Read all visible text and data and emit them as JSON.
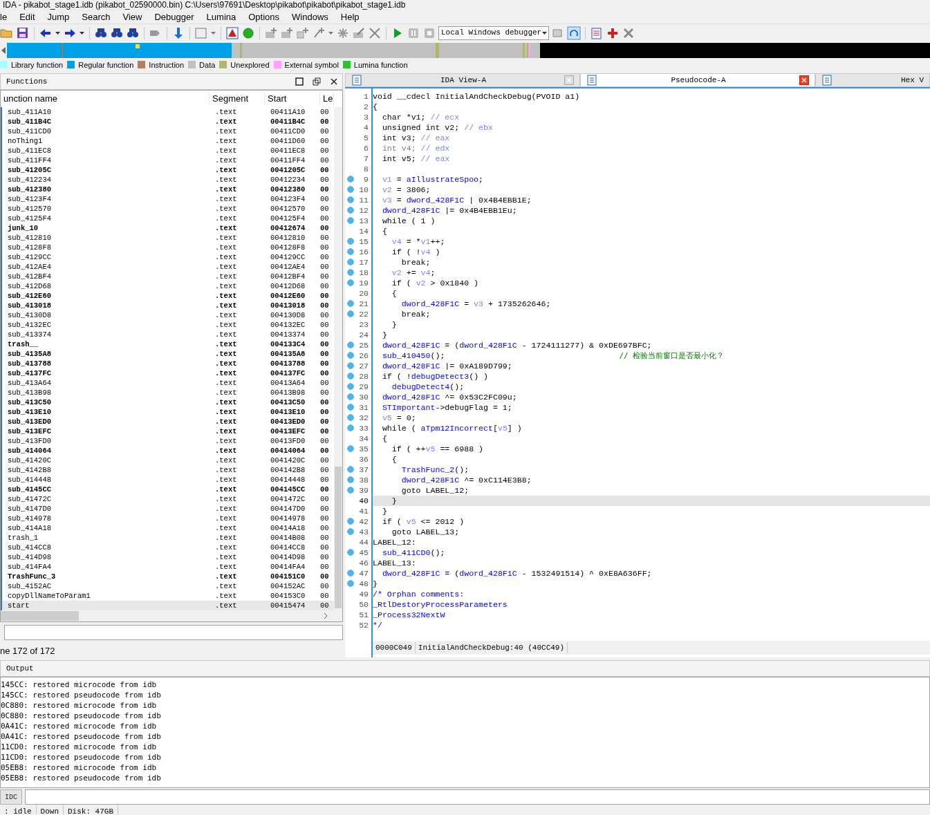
{
  "window": {
    "title": "IDA - pikabot_stage1.idb (pikabot_02590000.bin) C:\\Users\\97691\\Desktop\\pikabot\\pikabot\\pikabot_stage1.idb"
  },
  "menu": [
    "le",
    "Edit",
    "Jump",
    "Search",
    "View",
    "Debugger",
    "Lumina",
    "Options",
    "Windows",
    "Help"
  ],
  "debugger_select": {
    "value": "Local Windows debugger"
  },
  "legend": [
    {
      "label": "Library function",
      "color": "#a6ffff"
    },
    {
      "label": "Regular function",
      "color": "#00a0e6"
    },
    {
      "label": "Instruction",
      "color": "#b47f5c"
    },
    {
      "label": "Data",
      "color": "#c0c0c0"
    },
    {
      "label": "Unexplored",
      "color": "#b4b46e"
    },
    {
      "label": "External symbol",
      "color": "#ffa0ff"
    },
    {
      "label": "Lumina function",
      "color": "#30c030"
    }
  ],
  "functions": {
    "title": "Functions",
    "columns": [
      "unction name",
      "Segment",
      "Start",
      "Le"
    ],
    "rows": [
      {
        "name": "sub_411A10",
        "segment": ".text",
        "start": "00411A10",
        "length": "00",
        "bold": false,
        "selected": false
      },
      {
        "name": "sub_411B4C",
        "segment": ".text",
        "start": "00411B4C",
        "length": "00",
        "bold": true,
        "selected": false
      },
      {
        "name": "sub_411CD0",
        "segment": ".text",
        "start": "00411CD0",
        "length": "00",
        "bold": false,
        "selected": false
      },
      {
        "name": "noThing1",
        "segment": ".text",
        "start": "00411D60",
        "length": "00",
        "bold": false,
        "selected": false
      },
      {
        "name": "sub_411EC8",
        "segment": ".text",
        "start": "00411EC8",
        "length": "00",
        "bold": false,
        "selected": false
      },
      {
        "name": "sub_411FF4",
        "segment": ".text",
        "start": "00411FF4",
        "length": "00",
        "bold": false,
        "selected": false
      },
      {
        "name": "sub_41205C",
        "segment": ".text",
        "start": "0041205C",
        "length": "00",
        "bold": true,
        "selected": false
      },
      {
        "name": "sub_412234",
        "segment": ".text",
        "start": "00412234",
        "length": "00",
        "bold": false,
        "selected": false
      },
      {
        "name": "sub_412380",
        "segment": ".text",
        "start": "00412380",
        "length": "00",
        "bold": true,
        "selected": false
      },
      {
        "name": "sub_4123F4",
        "segment": ".text",
        "start": "004123F4",
        "length": "00",
        "bold": false,
        "selected": false
      },
      {
        "name": "sub_412570",
        "segment": ".text",
        "start": "00412570",
        "length": "00",
        "bold": false,
        "selected": false
      },
      {
        "name": "sub_4125F4",
        "segment": ".text",
        "start": "004125F4",
        "length": "00",
        "bold": false,
        "selected": false
      },
      {
        "name": "junk_10",
        "segment": ".text",
        "start": "00412674",
        "length": "00",
        "bold": true,
        "selected": false
      },
      {
        "name": "sub_412810",
        "segment": ".text",
        "start": "00412810",
        "length": "00",
        "bold": false,
        "selected": false
      },
      {
        "name": "sub_4128F8",
        "segment": ".text",
        "start": "004128F8",
        "length": "00",
        "bold": false,
        "selected": false
      },
      {
        "name": "sub_4129CC",
        "segment": ".text",
        "start": "004129CC",
        "length": "00",
        "bold": false,
        "selected": false
      },
      {
        "name": "sub_412AE4",
        "segment": ".text",
        "start": "00412AE4",
        "length": "00",
        "bold": false,
        "selected": false
      },
      {
        "name": "sub_412BF4",
        "segment": ".text",
        "start": "00412BF4",
        "length": "00",
        "bold": false,
        "selected": false
      },
      {
        "name": "sub_412D68",
        "segment": ".text",
        "start": "00412D68",
        "length": "00",
        "bold": false,
        "selected": false
      },
      {
        "name": "sub_412E60",
        "segment": ".text",
        "start": "00412E60",
        "length": "00",
        "bold": true,
        "selected": false
      },
      {
        "name": "sub_413018",
        "segment": ".text",
        "start": "00413018",
        "length": "00",
        "bold": true,
        "selected": false
      },
      {
        "name": "sub_4130D8",
        "segment": ".text",
        "start": "004130D8",
        "length": "00",
        "bold": false,
        "selected": false
      },
      {
        "name": "sub_4132EC",
        "segment": ".text",
        "start": "004132EC",
        "length": "00",
        "bold": false,
        "selected": false
      },
      {
        "name": "sub_413374",
        "segment": ".text",
        "start": "00413374",
        "length": "00",
        "bold": false,
        "selected": false
      },
      {
        "name": "trash__",
        "segment": ".text",
        "start": "004133C4",
        "length": "00",
        "bold": true,
        "selected": false
      },
      {
        "name": "sub_4135A8",
        "segment": ".text",
        "start": "004135A8",
        "length": "00",
        "bold": true,
        "selected": false
      },
      {
        "name": "sub_413788",
        "segment": ".text",
        "start": "00413788",
        "length": "00",
        "bold": true,
        "selected": false
      },
      {
        "name": "sub_4137FC",
        "segment": ".text",
        "start": "004137FC",
        "length": "00",
        "bold": true,
        "selected": false
      },
      {
        "name": "sub_413A64",
        "segment": ".text",
        "start": "00413A64",
        "length": "00",
        "bold": false,
        "selected": false
      },
      {
        "name": "sub_413B98",
        "segment": ".text",
        "start": "00413B98",
        "length": "00",
        "bold": false,
        "selected": false
      },
      {
        "name": "sub_413C50",
        "segment": ".text",
        "start": "00413C50",
        "length": "00",
        "bold": true,
        "selected": false
      },
      {
        "name": "sub_413E10",
        "segment": ".text",
        "start": "00413E10",
        "length": "00",
        "bold": true,
        "selected": false
      },
      {
        "name": "sub_413ED0",
        "segment": ".text",
        "start": "00413ED0",
        "length": "00",
        "bold": true,
        "selected": false
      },
      {
        "name": "sub_413EFC",
        "segment": ".text",
        "start": "00413EFC",
        "length": "00",
        "bold": true,
        "selected": false
      },
      {
        "name": "sub_413FD0",
        "segment": ".text",
        "start": "00413FD0",
        "length": "00",
        "bold": false,
        "selected": false
      },
      {
        "name": "sub_414064",
        "segment": ".text",
        "start": "00414064",
        "length": "00",
        "bold": true,
        "selected": false
      },
      {
        "name": "sub_41420C",
        "segment": ".text",
        "start": "0041420C",
        "length": "00",
        "bold": false,
        "selected": false
      },
      {
        "name": "sub_4142B8",
        "segment": ".text",
        "start": "004142B8",
        "length": "00",
        "bold": false,
        "selected": false
      },
      {
        "name": "sub_414448",
        "segment": ".text",
        "start": "00414448",
        "length": "00",
        "bold": false,
        "selected": false
      },
      {
        "name": "sub_4145CC",
        "segment": ".text",
        "start": "004145CC",
        "length": "00",
        "bold": true,
        "selected": false
      },
      {
        "name": "sub_41472C",
        "segment": ".text",
        "start": "0041472C",
        "length": "00",
        "bold": false,
        "selected": false
      },
      {
        "name": "sub_4147D0",
        "segment": ".text",
        "start": "004147D0",
        "length": "00",
        "bold": false,
        "selected": false
      },
      {
        "name": "sub_414978",
        "segment": ".text",
        "start": "00414978",
        "length": "00",
        "bold": false,
        "selected": false
      },
      {
        "name": "sub_414A18",
        "segment": ".text",
        "start": "00414A18",
        "length": "00",
        "bold": false,
        "selected": false
      },
      {
        "name": "trash_1",
        "segment": ".text",
        "start": "00414B08",
        "length": "00",
        "bold": false,
        "selected": false
      },
      {
        "name": "sub_414CC8",
        "segment": ".text",
        "start": "00414CC8",
        "length": "00",
        "bold": false,
        "selected": false
      },
      {
        "name": "sub_414D98",
        "segment": ".text",
        "start": "00414D98",
        "length": "00",
        "bold": false,
        "selected": false
      },
      {
        "name": "sub_414FA4",
        "segment": ".text",
        "start": "00414FA4",
        "length": "00",
        "bold": false,
        "selected": false
      },
      {
        "name": "TrashFunc_3",
        "segment": ".text",
        "start": "004151C0",
        "length": "00",
        "bold": true,
        "selected": false
      },
      {
        "name": "sub_4152AC",
        "segment": ".text",
        "start": "004152AC",
        "length": "00",
        "bold": false,
        "selected": false
      },
      {
        "name": "copyDllNameToParam1",
        "segment": ".text",
        "start": "004153C0",
        "length": "00",
        "bold": false,
        "selected": false
      },
      {
        "name": "start",
        "segment": ".text",
        "start": "00415474",
        "length": "00",
        "bold": false,
        "selected": true
      }
    ],
    "footer": "ne 172 of 172"
  },
  "tabs": [
    {
      "label": "IDA View-A",
      "selected": false,
      "closable": true
    },
    {
      "label": "Pseudocode-A",
      "selected": true,
      "closable": true
    },
    {
      "label": "Hex V",
      "selected": false,
      "closable": false
    }
  ],
  "code_lines": [
    {
      "number": "1",
      "dot": false,
      "highlighted": false,
      "parts": [
        {
          "kind": "plain",
          "text": "void __cdecl InitialAndCheckDebug(PVOID a1)"
        }
      ]
    },
    {
      "number": "2",
      "dot": false,
      "highlighted": false,
      "parts": [
        {
          "kind": "plain",
          "text": "{"
        }
      ]
    },
    {
      "number": "3",
      "dot": false,
      "highlighted": false,
      "parts": [
        {
          "kind": "plain",
          "text": "  char *v1; "
        },
        {
          "kind": "local",
          "text": "// ecx"
        }
      ]
    },
    {
      "number": "4",
      "dot": false,
      "highlighted": false,
      "parts": [
        {
          "kind": "plain",
          "text": "  unsigned int v2; "
        },
        {
          "kind": "local",
          "text": "// ebx"
        }
      ]
    },
    {
      "number": "5",
      "dot": false,
      "highlighted": false,
      "parts": [
        {
          "kind": "plain",
          "text": "  int v3; "
        },
        {
          "kind": "local",
          "text": "// eax"
        }
      ]
    },
    {
      "number": "6",
      "dot": false,
      "highlighted": false,
      "parts": [
        {
          "kind": "dim",
          "text": "  int v4; "
        },
        {
          "kind": "local",
          "text": "// edx"
        }
      ]
    },
    {
      "number": "7",
      "dot": false,
      "highlighted": false,
      "parts": [
        {
          "kind": "plain",
          "text": "  int v5; "
        },
        {
          "kind": "local",
          "text": "// eax"
        }
      ]
    },
    {
      "number": "8",
      "dot": false,
      "highlighted": false
    },
    {
      "number": "9",
      "dot": true,
      "highlighted": false,
      "parts": [
        {
          "kind": "local",
          "text": "  v1"
        },
        {
          "kind": "plain",
          "text": " = "
        },
        {
          "kind": "global",
          "text": "aIllustrateSpoo"
        },
        {
          "kind": "plain",
          "text": ";"
        }
      ]
    },
    {
      "number": "10",
      "dot": true,
      "highlighted": false,
      "parts": [
        {
          "kind": "local",
          "text": "  v2"
        },
        {
          "kind": "plain",
          "text": " = 3806;"
        }
      ]
    },
    {
      "number": "11",
      "dot": true,
      "highlighted": false,
      "parts": [
        {
          "kind": "local",
          "text": "  v3"
        },
        {
          "kind": "plain",
          "text": " = "
        },
        {
          "kind": "global",
          "text": "dword_428F1C"
        },
        {
          "kind": "plain",
          "text": " | 0x4B4EBB1E;"
        }
      ]
    },
    {
      "number": "12",
      "dot": true,
      "highlighted": false,
      "parts": [
        {
          "kind": "global",
          "text": "  dword_428F1C"
        },
        {
          "kind": "plain",
          "text": " |= 0x4B4EBB1Eu;"
        }
      ]
    },
    {
      "number": "13",
      "dot": true,
      "highlighted": false,
      "parts": [
        {
          "kind": "plain",
          "text": "  while ( 1 )"
        }
      ]
    },
    {
      "number": "14",
      "dot": false,
      "highlighted": false,
      "parts": [
        {
          "kind": "plain",
          "text": "  {"
        }
      ]
    },
    {
      "number": "15",
      "dot": true,
      "highlighted": false,
      "parts": [
        {
          "kind": "local",
          "text": "    v4"
        },
        {
          "kind": "plain",
          "text": " = *"
        },
        {
          "kind": "local",
          "text": "v1"
        },
        {
          "kind": "plain",
          "text": "++;"
        }
      ]
    },
    {
      "number": "16",
      "dot": true,
      "highlighted": false,
      "parts": [
        {
          "kind": "plain",
          "text": "    if ( !"
        },
        {
          "kind": "local",
          "text": "v4"
        },
        {
          "kind": "plain",
          "text": " )"
        }
      ]
    },
    {
      "number": "17",
      "dot": true,
      "highlighted": false,
      "parts": [
        {
          "kind": "plain",
          "text": "      break;"
        }
      ]
    },
    {
      "number": "18",
      "dot": true,
      "highlighted": false,
      "parts": [
        {
          "kind": "local",
          "text": "    v2"
        },
        {
          "kind": "plain",
          "text": " += "
        },
        {
          "kind": "local",
          "text": "v4"
        },
        {
          "kind": "plain",
          "text": ";"
        }
      ]
    },
    {
      "number": "19",
      "dot": true,
      "highlighted": false,
      "parts": [
        {
          "kind": "plain",
          "text": "    if ( "
        },
        {
          "kind": "local",
          "text": "v2"
        },
        {
          "kind": "plain",
          "text": " > 0x1840 )"
        }
      ]
    },
    {
      "number": "20",
      "dot": false,
      "highlighted": false,
      "parts": [
        {
          "kind": "plain",
          "text": "    {"
        }
      ]
    },
    {
      "number": "21",
      "dot": true,
      "highlighted": false,
      "parts": [
        {
          "kind": "global",
          "text": "      dword_428F1C"
        },
        {
          "kind": "plain",
          "text": " = "
        },
        {
          "kind": "local",
          "text": "v3"
        },
        {
          "kind": "plain",
          "text": " + 1735262646;"
        }
      ]
    },
    {
      "number": "22",
      "dot": true,
      "highlighted": false,
      "parts": [
        {
          "kind": "plain",
          "text": "      break;"
        }
      ]
    },
    {
      "number": "23",
      "dot": false,
      "highlighted": false,
      "parts": [
        {
          "kind": "plain",
          "text": "    }"
        }
      ]
    },
    {
      "number": "24",
      "dot": false,
      "highlighted": false,
      "parts": [
        {
          "kind": "plain",
          "text": "  }"
        }
      ]
    },
    {
      "number": "25",
      "dot": true,
      "highlighted": false,
      "parts": [
        {
          "kind": "global",
          "text": "  dword_428F1C"
        },
        {
          "kind": "plain",
          "text": " = ("
        },
        {
          "kind": "global",
          "text": "dword_428F1C"
        },
        {
          "kind": "plain",
          "text": " - 1724111277) & 0xDE697BFC;"
        }
      ]
    },
    {
      "number": "26",
      "dot": true,
      "highlighted": false,
      "parts": [
        {
          "kind": "global",
          "text": "  sub_410450"
        },
        {
          "kind": "plain",
          "text": "();"
        },
        {
          "kind": "comment",
          "text": "// 检验当前窗口是否最小化？"
        }
      ]
    },
    {
      "number": "27",
      "dot": true,
      "highlighted": false,
      "parts": [
        {
          "kind": "global",
          "text": "  dword_428F1C"
        },
        {
          "kind": "plain",
          "text": " |= 0xA189D799;"
        }
      ]
    },
    {
      "number": "28",
      "dot": true,
      "highlighted": false,
      "parts": [
        {
          "kind": "plain",
          "text": "  if ( !"
        },
        {
          "kind": "global",
          "text": "debugDetect3"
        },
        {
          "kind": "plain",
          "text": "() )"
        }
      ]
    },
    {
      "number": "29",
      "dot": true,
      "highlighted": false,
      "parts": [
        {
          "kind": "global",
          "text": "    debugDetect4"
        },
        {
          "kind": "plain",
          "text": "();"
        }
      ]
    },
    {
      "number": "30",
      "dot": true,
      "highlighted": false,
      "parts": [
        {
          "kind": "global",
          "text": "  dword_428F1C"
        },
        {
          "kind": "plain",
          "text": " ^= 0x53C2FC09u;"
        }
      ]
    },
    {
      "number": "31",
      "dot": true,
      "highlighted": false,
      "parts": [
        {
          "kind": "global",
          "text": "  STImportant"
        },
        {
          "kind": "plain",
          "text": "->debugFlag = 1;"
        }
      ]
    },
    {
      "number": "32",
      "dot": true,
      "highlighted": false,
      "parts": [
        {
          "kind": "local",
          "text": "  v5"
        },
        {
          "kind": "plain",
          "text": " = 0;"
        }
      ]
    },
    {
      "number": "33",
      "dot": true,
      "highlighted": false,
      "parts": [
        {
          "kind": "plain",
          "text": "  while ( "
        },
        {
          "kind": "global",
          "text": "aTpm12Incorrect"
        },
        {
          "kind": "plain",
          "text": "["
        },
        {
          "kind": "local",
          "text": "v5"
        },
        {
          "kind": "plain",
          "text": "] )"
        }
      ]
    },
    {
      "number": "34",
      "dot": false,
      "highlighted": false,
      "parts": [
        {
          "kind": "plain",
          "text": "  {"
        }
      ]
    },
    {
      "number": "35",
      "dot": true,
      "highlighted": false,
      "parts": [
        {
          "kind": "plain",
          "text": "    if ( ++"
        },
        {
          "kind": "local",
          "text": "v5"
        },
        {
          "kind": "plain",
          "text": " == 6988 )"
        }
      ]
    },
    {
      "number": "36",
      "dot": false,
      "highlighted": false,
      "parts": [
        {
          "kind": "plain",
          "text": "    {"
        }
      ]
    },
    {
      "number": "37",
      "dot": true,
      "highlighted": false,
      "parts": [
        {
          "kind": "global",
          "text": "      TrashFunc_2"
        },
        {
          "kind": "plain",
          "text": "();"
        }
      ]
    },
    {
      "number": "38",
      "dot": true,
      "highlighted": false,
      "parts": [
        {
          "kind": "global",
          "text": "      dword_428F1C"
        },
        {
          "kind": "plain",
          "text": " ^= 0xC114E3B8;"
        }
      ]
    },
    {
      "number": "39",
      "dot": true,
      "highlighted": false,
      "parts": [
        {
          "kind": "plain",
          "text": "      goto LABEL_12;"
        }
      ]
    },
    {
      "number": "40",
      "dot": false,
      "highlighted": true,
      "parts": [
        {
          "kind": "plain",
          "text": "    }"
        }
      ]
    },
    {
      "number": "41",
      "dot": false,
      "highlighted": false,
      "parts": [
        {
          "kind": "plain",
          "text": "  }"
        }
      ]
    },
    {
      "number": "42",
      "dot": true,
      "highlighted": false,
      "parts": [
        {
          "kind": "plain",
          "text": "  if ( "
        },
        {
          "kind": "local",
          "text": "v5"
        },
        {
          "kind": "plain",
          "text": " <= 2012 )"
        }
      ]
    },
    {
      "number": "43",
      "dot": true,
      "highlighted": false,
      "parts": [
        {
          "kind": "plain",
          "text": "    goto LABEL_13;"
        }
      ]
    },
    {
      "number": "44",
      "dot": false,
      "highlighted": false,
      "parts": [
        {
          "kind": "plain",
          "text": "LABEL_12:"
        }
      ]
    },
    {
      "number": "45",
      "dot": true,
      "highlighted": false,
      "parts": [
        {
          "kind": "global",
          "text": "  sub_411CD0"
        },
        {
          "kind": "plain",
          "text": "();"
        }
      ]
    },
    {
      "number": "46",
      "dot": false,
      "highlighted": false,
      "parts": [
        {
          "kind": "plain",
          "text": "LABEL_13:"
        }
      ]
    },
    {
      "number": "47",
      "dot": true,
      "highlighted": false,
      "parts": [
        {
          "kind": "global",
          "text": "  dword_428F1C"
        },
        {
          "kind": "plain",
          "text": " = ("
        },
        {
          "kind": "global",
          "text": "dword_428F1C"
        },
        {
          "kind": "plain",
          "text": " - 1532491514) ^ 0xE8A636FF;"
        }
      ]
    },
    {
      "number": "48",
      "dot": true,
      "highlighted": false,
      "parts": [
        {
          "kind": "plain",
          "text": "}"
        }
      ]
    },
    {
      "number": "49",
      "dot": false,
      "highlighted": false,
      "parts": [
        {
          "kind": "global",
          "text": "/* Orphan comments:"
        }
      ]
    },
    {
      "number": "50",
      "dot": false,
      "highlighted": false,
      "parts": [
        {
          "kind": "global",
          "text": "_RtlDestoryProcessParameters"
        }
      ]
    },
    {
      "number": "51",
      "dot": false,
      "highlighted": false,
      "parts": [
        {
          "kind": "global",
          "text": "_Process32NextW"
        }
      ]
    },
    {
      "number": "52",
      "dot": false,
      "highlighted": false,
      "parts": [
        {
          "kind": "global",
          "text": "*/"
        }
      ]
    }
  ],
  "code_status": [
    "0000C049",
    "InitialAndCheckDebug:40 (40CC49)"
  ],
  "output": {
    "title": "Output",
    "lines": [
      "145CC: restored microcode from idb",
      "145CC: restored pseudocode from idb",
      "0C880: restored microcode from idb",
      "0C880: restored pseudocode from idb",
      "0A41C: restored microcode from idb",
      "0A41C: restored pseudocode from idb",
      "11CD0: restored microcode from idb",
      "11CD0: restored pseudocode from idb",
      "05EB8: restored microcode from idb",
      "05EB8: restored pseudocode from idb"
    ]
  },
  "command": {
    "language": "IDC"
  },
  "status_bar": [
    ": idle",
    "Down",
    "Disk: 47GB"
  ]
}
